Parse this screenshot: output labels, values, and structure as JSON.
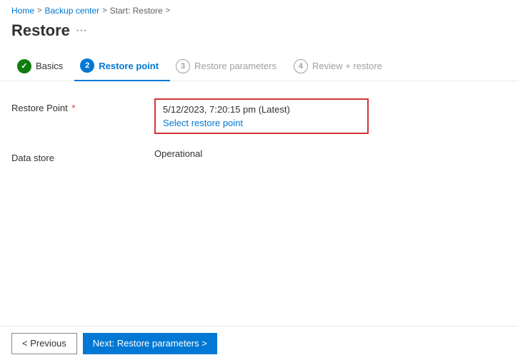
{
  "breadcrumb": {
    "items": [
      {
        "label": "Home",
        "key": "home"
      },
      {
        "label": "Backup center",
        "key": "backup-center"
      },
      {
        "label": "Start: Restore",
        "key": "start-restore"
      }
    ],
    "separator": ">"
  },
  "page": {
    "title": "Restore",
    "more_icon": "···"
  },
  "wizard": {
    "steps": [
      {
        "number": "✓",
        "label": "Basics",
        "state": "done",
        "key": "basics"
      },
      {
        "number": "2",
        "label": "Restore point",
        "state": "current",
        "key": "restore-point"
      },
      {
        "number": "3",
        "label": "Restore parameters",
        "state": "pending",
        "key": "restore-parameters"
      },
      {
        "number": "4",
        "label": "Review + restore",
        "state": "pending",
        "key": "review-restore"
      }
    ]
  },
  "form": {
    "restore_point": {
      "label": "Restore Point",
      "required": true,
      "value": "5/12/2023, 7:20:15 pm (Latest)",
      "select_link": "Select restore point"
    },
    "data_store": {
      "label": "Data store",
      "value": "Operational"
    }
  },
  "footer": {
    "prev_label": "< Previous",
    "next_label": "Next: Restore parameters >"
  }
}
